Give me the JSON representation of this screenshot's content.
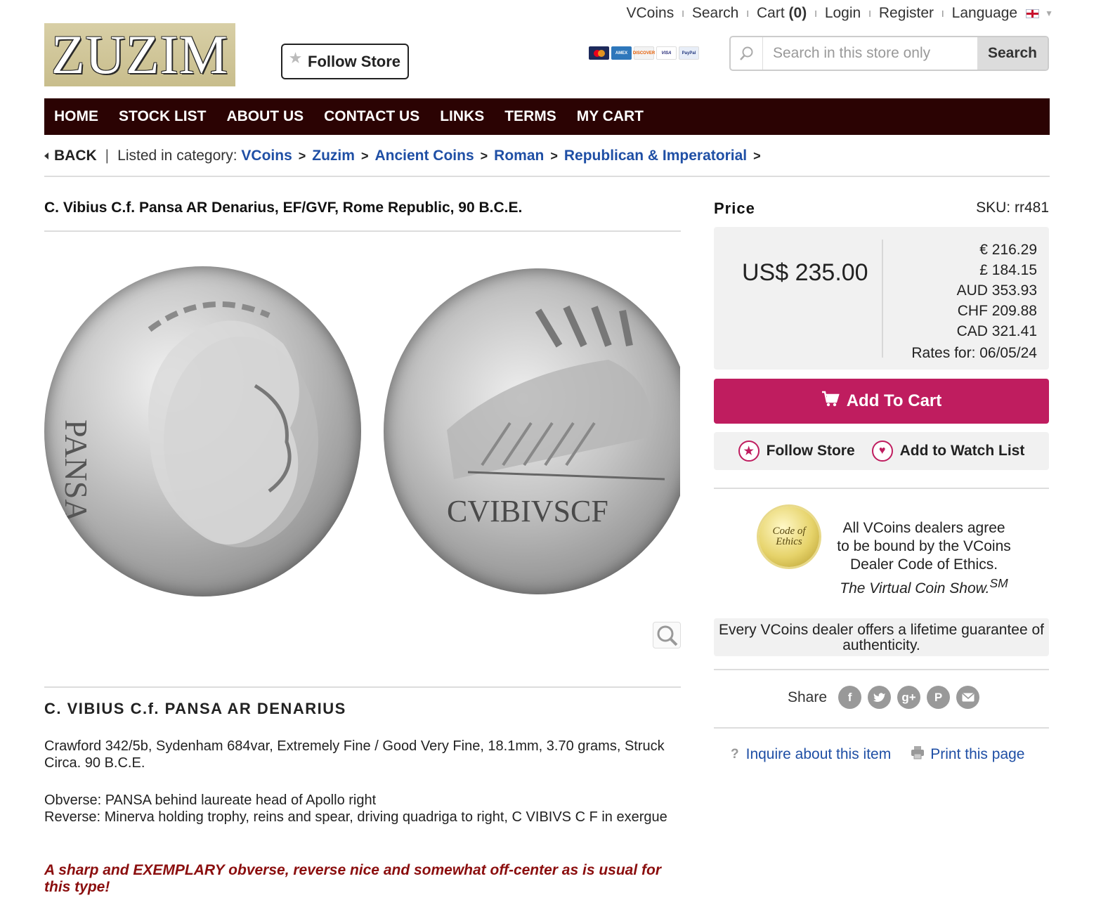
{
  "topbar": {
    "vcoins": "VCoins",
    "search": "Search",
    "cart": "Cart",
    "cart_count": "(0)",
    "login": "Login",
    "register": "Register",
    "language": "Language"
  },
  "logo": {
    "text": "ZUZIM"
  },
  "follow_store_top": "Follow Store",
  "payment_cards": [
    "MasterCard",
    "AMEX",
    "DISCOVER",
    "VISA",
    "PayPal"
  ],
  "search": {
    "placeholder": "Search in this store only",
    "button": "Search"
  },
  "nav": [
    "HOME",
    "STOCK LIST",
    "ABOUT US",
    "CONTACT US",
    "LINKS",
    "TERMS",
    "MY CART"
  ],
  "breadcrumb": {
    "back": "BACK",
    "listed": "Listed in category:",
    "items": [
      "VCoins",
      "Zuzim",
      "Ancient Coins",
      "Roman",
      "Republican & Imperatorial"
    ]
  },
  "product": {
    "title": "C. Vibius C.f. Pansa AR Denarius, EF/GVF, Rome Republic, 90 B.C.E.",
    "coin_obverse_legend": "PANSA",
    "coin_reverse_legend": "CVIBIVSCF",
    "subhead": "C. VIBIUS C.f. PANSA AR DENARIUS",
    "desc1": "Crawford 342/5b, Sydenham 684var, Extremely  Fine / Good Very Fine, 18.1mm, 3.70 grams, Struck Circa. 90 B.C.E.",
    "obverse": "Obverse: PANSA behind laureate head of Apollo right",
    "reverse": "Reverse:  Minerva holding trophy, reins and spear, driving quadriga to right, C VIBIVS C F in exergue",
    "note": "A sharp and EXEMPLARY obverse, reverse nice and somewhat off-center as is usual for this type!"
  },
  "price": {
    "label": "Price",
    "sku": "SKU: rr481",
    "main": "US$ 235.00",
    "eur": "€ 216.29",
    "gbp": "£ 184.15",
    "aud": "AUD 353.93",
    "chf": "CHF 209.88",
    "cad": "CAD 321.41",
    "rates_date": "Rates for: 06/05/24"
  },
  "actions": {
    "add_to_cart": "Add To Cart",
    "follow_store": "Follow Store",
    "watch_list": "Add to Watch List"
  },
  "ethics": {
    "seal_line1": "Code of",
    "seal_line2": "Ethics",
    "text": "All VCoins dealers agree to be bound by the VCoins Dealer Code of Ethics.",
    "italic": "The Virtual Coin Show.",
    "sup": "SM",
    "guarantee": "Every VCoins dealer offers a lifetime guarantee of authenticity."
  },
  "share": {
    "label": "Share"
  },
  "footer_links": {
    "inquire": "Inquire about this item",
    "print": "Print this page"
  },
  "colors": {
    "nav_bg": "#2b0303",
    "add_to_cart": "#bf1d5f",
    "link": "#1f4fa5",
    "note": "#8b0e0e"
  }
}
